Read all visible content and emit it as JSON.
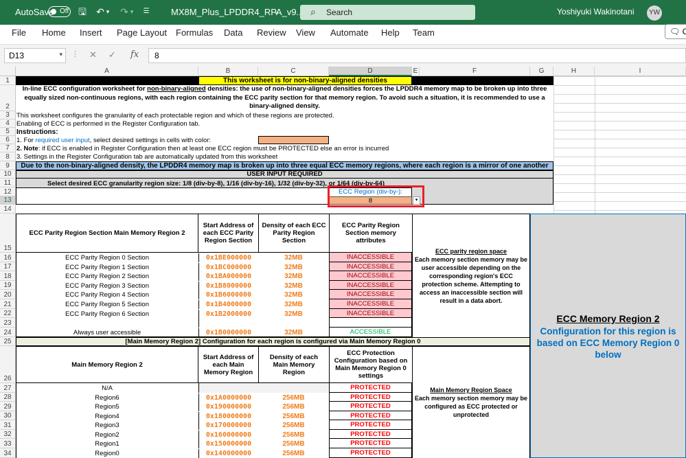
{
  "titlebar": {
    "autosave_label": "AutoSave",
    "autosave_state": "Off",
    "filename": "MX8M_Plus_LPDDR4_RPA_v9...",
    "search_placeholder": "Search",
    "user_name": "Yoshiyuki Wakinotani",
    "user_initials": "YW"
  },
  "menu": [
    "File",
    "Home",
    "Insert",
    "Page Layout",
    "Formulas",
    "Data",
    "Review",
    "View",
    "Automate",
    "Help",
    "Team"
  ],
  "comments_label": "Co",
  "formula_bar": {
    "cell_ref": "D13",
    "formula": "8"
  },
  "columns": [
    "A",
    "B",
    "C",
    "D",
    "E",
    "F",
    "G",
    "H",
    "I"
  ],
  "rows": [
    "1",
    "2",
    "3",
    "4",
    "5",
    "6",
    "7",
    "8",
    "9",
    "10",
    "11",
    "12",
    "13",
    "14",
    "15",
    "16",
    "17",
    "18",
    "19",
    "20",
    "21",
    "22",
    "23",
    "24",
    "25",
    "26",
    "27",
    "28",
    "29",
    "30",
    "31",
    "32",
    "33",
    "34"
  ],
  "sheet": {
    "r1_title": "This worksheet is for non-binary-aligned densities",
    "r2_prefix": "In-line ECC configuration worksheet for ",
    "r2_underlined": "non-binary-aligned",
    "r2_rest": " densities: the use of non-binary-aligned densities forces the LPDDR4 memory map to be broken up into three equally sized non-continuous regions, with each region containing the ECC parity section for that memory region.  To avoid such a situation, it is recommended to use a binary-aligned density.",
    "r3": "This worksheet configures the granularity of each protectable region and which of these regions are protected.",
    "r4": "Enabling of ECC is performed in the Register Configuration tab.",
    "r5": "Instructions:",
    "r6_prefix": "1. For ",
    "r6_link": "required user input",
    "r6_rest": ", select desired settings in cells with color:",
    "r7_bold": "2. Note",
    "r7_rest": ": if ECC is enabled in Register Configuration then at least one ECC region must be PROTECTED else an error is incurred",
    "r8": "3. Settings in the Register Configuration tab are automatically updated from this worksheet",
    "r9_banner": "Due to the non-binary-aligned density, the LPDDR4 memory map is broken up into three equal ECC memory regions, where each region is a mirror of one another",
    "r10": "USER INPUT REQUIRED",
    "r11": "Select desired ECC granularity region size: 1/8 (div-by-8), 1/16 (div-by-16), 1/32 (div-by-32), or 1/64 (div-by-64)",
    "ecc_region_label": "ECC Region (div-by-):",
    "ecc_region_value": "8",
    "parity_table": {
      "h_section": "ECC Parity Region Section Main Memory Region 2",
      "h_start": "Start Address of each ECC Parity Region Section",
      "h_density": "Density of each ECC Parity Region Section",
      "h_attr": "ECC Parity Region Section memory attributes",
      "rows": [
        {
          "name": "ECC Parity Region 0 Section",
          "addr": "0x1BE000000",
          "density": "32MB",
          "attr": "INACCESSIBLE"
        },
        {
          "name": "ECC Parity Region 1 Section",
          "addr": "0x1BC000000",
          "density": "32MB",
          "attr": "INACCESSIBLE"
        },
        {
          "name": "ECC Parity Region 2 Section",
          "addr": "0x1BA000000",
          "density": "32MB",
          "attr": "INACCESSIBLE"
        },
        {
          "name": "ECC Parity Region 3 Section",
          "addr": "0x1B8000000",
          "density": "32MB",
          "attr": "INACCESSIBLE"
        },
        {
          "name": "ECC Parity Region 4 Section",
          "addr": "0x1B6000000",
          "density": "32MB",
          "attr": "INACCESSIBLE"
        },
        {
          "name": "ECC Parity Region 5 Section",
          "addr": "0x1B4000000",
          "density": "32MB",
          "attr": "INACCESSIBLE"
        },
        {
          "name": "ECC Parity Region 6 Section",
          "addr": "0x1B2000000",
          "density": "32MB",
          "attr": "INACCESSIBLE"
        }
      ],
      "always_row": {
        "name": "Always user accessible",
        "addr": "0x1B0000000",
        "density": "32MB",
        "attr": "ACCESSIBLE"
      },
      "note_title": "ECC parity region space",
      "note_body": "Each memory section memory may be user accessible depending on the corresponding region's ECC protection scheme. Attempting to access an inaccessible section will result in a data abort."
    },
    "r25_banner": "[Main Memory Region 2] Configuration for each region is configured via Main Memory Region 0",
    "main_table": {
      "h_region": "Main Memory Region 2",
      "h_start": "Start Address of each Main Memory Region",
      "h_density": "Density of each Main Memory Region",
      "h_attr": "ECC Protection Configuration based on Main Memory Region 0 settings",
      "na_row": {
        "name": "N/A",
        "attr": "PROTECTED"
      },
      "rows": [
        {
          "name": "Region6",
          "addr": "0x1A0000000",
          "density": "256MB",
          "attr": "PROTECTED"
        },
        {
          "name": "Region5",
          "addr": "0x190000000",
          "density": "256MB",
          "attr": "PROTECTED"
        },
        {
          "name": "Region4",
          "addr": "0x180000000",
          "density": "256MB",
          "attr": "PROTECTED"
        },
        {
          "name": "Region3",
          "addr": "0x170000000",
          "density": "256MB",
          "attr": "PROTECTED"
        },
        {
          "name": "Region2",
          "addr": "0x160000000",
          "density": "256MB",
          "attr": "PROTECTED"
        },
        {
          "name": "Region1",
          "addr": "0x150000000",
          "density": "256MB",
          "attr": "PROTECTED"
        },
        {
          "name": "Region0",
          "addr": "0x140000000",
          "density": "256MB",
          "attr": "PROTECTED"
        }
      ],
      "note_title": "Main Memory Region Space",
      "note_body": "Each memory section memory may be configured as ECC protected or unprotected"
    },
    "side_panel": {
      "title": "ECC Memory Region 2",
      "body": "Configuration for this region is based on ECC Memory Region 0 below"
    }
  },
  "colors": {
    "excel_green": "#217346",
    "title_yellow": "#ffff00",
    "input_orange": "#f4b183",
    "banner_blue": "#9dc3e6",
    "banner_olive": "#ebf1de",
    "inaccessible_pink": "#ffc7ce",
    "protected_red": "#ff0000",
    "accessible_green": "#00b050",
    "address_orange": "#f07d1c",
    "side_panel_gray": "#d9d9d9",
    "side_panel_blue": "#0070c0",
    "highlight_red": "#e8202a"
  }
}
